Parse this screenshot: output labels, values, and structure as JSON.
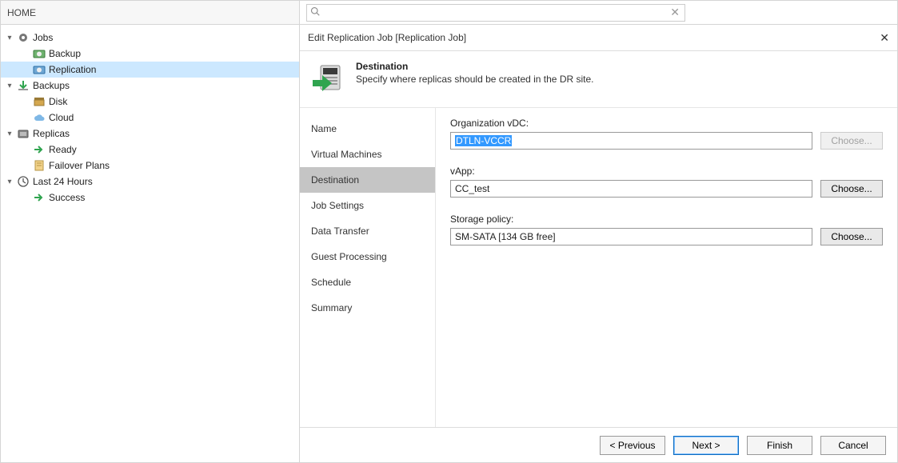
{
  "sidebar": {
    "header": "HOME",
    "items": [
      {
        "label": "Jobs",
        "indent": 0,
        "icon": "gear",
        "exp": "▾"
      },
      {
        "label": "Backup",
        "indent": 1,
        "icon": "safeg",
        "exp": ""
      },
      {
        "label": "Replication",
        "indent": 1,
        "icon": "safeb",
        "exp": "",
        "selected": true
      },
      {
        "label": "Backups",
        "indent": 0,
        "icon": "arrowg",
        "exp": "▾"
      },
      {
        "label": "Disk",
        "indent": 1,
        "icon": "disk",
        "exp": ""
      },
      {
        "label": "Cloud",
        "indent": 1,
        "icon": "cloud",
        "exp": ""
      },
      {
        "label": "Replicas",
        "indent": 0,
        "icon": "diskg",
        "exp": "▾"
      },
      {
        "label": "Ready",
        "indent": 1,
        "icon": "arrowr",
        "exp": ""
      },
      {
        "label": "Failover Plans",
        "indent": 1,
        "icon": "plan",
        "exp": ""
      },
      {
        "label": "Last 24 Hours",
        "indent": 0,
        "icon": "clock",
        "exp": "▾"
      },
      {
        "label": "Success",
        "indent": 1,
        "icon": "ok",
        "exp": ""
      }
    ]
  },
  "search": {
    "placeholder": ""
  },
  "dialog": {
    "title": "Edit Replication Job [Replication Job]",
    "banner": {
      "title": "Destination",
      "desc": "Specify where replicas should be created in the DR site."
    },
    "steps": [
      "Name",
      "Virtual Machines",
      "Destination",
      "Job Settings",
      "Data Transfer",
      "Guest Processing",
      "Schedule",
      "Summary"
    ],
    "active_step": 2,
    "fields": {
      "org_label": "Organization vDC:",
      "org_value": "DTLN-VCCR",
      "org_btn": "Choose...",
      "vapp_label": "vApp:",
      "vapp_value": "CC_test",
      "vapp_btn": "Choose...",
      "sp_label": "Storage policy:",
      "sp_value": "SM-SATA [134 GB free]",
      "sp_btn": "Choose..."
    },
    "footer": {
      "prev": "< Previous",
      "next": "Next >",
      "finish": "Finish",
      "cancel": "Cancel"
    }
  }
}
